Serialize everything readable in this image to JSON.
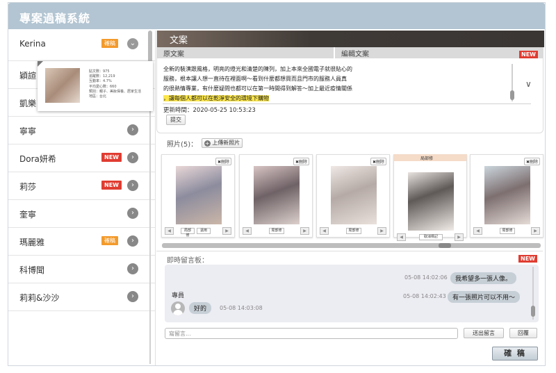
{
  "app": {
    "title": "專案過稿系統"
  },
  "sidebar": {
    "items": [
      {
        "name": "Kerina",
        "badge": "確稿",
        "badge_type": "orange",
        "expanded": true
      },
      {
        "name": "穎諠",
        "badge": "",
        "badge_type": ""
      },
      {
        "name": "凱樂",
        "badge": "",
        "badge_type": ""
      },
      {
        "name": "寧寧",
        "badge": "",
        "badge_type": ""
      },
      {
        "name": "Dora妍希",
        "badge": "NEW",
        "badge_type": "red"
      },
      {
        "name": "莉莎",
        "badge": "NEW",
        "badge_type": "red"
      },
      {
        "name": "奎寧",
        "badge": "",
        "badge_type": ""
      },
      {
        "name": "瑪麗雅",
        "badge": "確稿",
        "badge_type": "orange"
      },
      {
        "name": "科博聞",
        "badge": "",
        "badge_type": ""
      },
      {
        "name": "莉莉&沙沙",
        "badge": "",
        "badge_type": ""
      }
    ],
    "popup": {
      "stats": [
        "貼文數：975",
        "追蹤數：12,219",
        "互動率：4.7%",
        "平均愛心數：660",
        "類別：親子、美妝保養、居家生活",
        "地區：台北"
      ]
    }
  },
  "copy": {
    "header": "文案",
    "col_original": "原文案",
    "col_edit": "編輯文案",
    "new_label": "NEW",
    "lines": [
      "全新的裝潢跟風格，明亮的燈光和清楚的陳列，加上本來全國電子就很貼心的",
      "服務，根本讓人想一直待在裡面啊～看到什麼都想買而且門市的服務人員真",
      "的很熱情專業，有什麼疑問也都可以在第一時間得到解答～加上最近疫情關係"
    ],
    "highlight_line": "，讓每個人都可以在乾淨安全的環境下購物",
    "updated": "更新時間：2020-05-25 10:53:23",
    "submit_label": "提交"
  },
  "photos": {
    "label": "照片(5)：",
    "upload_label": "上傳新照片",
    "cards": [
      {
        "tag": "刪除",
        "tag_icon": "✖",
        "actions": [
          "局部修",
          "退用"
        ]
      },
      {
        "tag": "刪除",
        "tag_icon": "✖",
        "actions": [
          "局部修"
        ]
      },
      {
        "tag": "刪除",
        "tag_icon": "✖",
        "actions": [
          "局部修"
        ]
      },
      {
        "tag": "局部修",
        "tag_icon": "",
        "actions": [
          "取消標記"
        ],
        "selected": true
      },
      {
        "tag": "刪除",
        "tag_icon": "✖",
        "actions": [
          "局部修"
        ]
      }
    ]
  },
  "chat": {
    "label": "即時留言板：",
    "new_label": "NEW",
    "messages": [
      {
        "side": "right",
        "time": "05-08 14:02:06",
        "text": "我希望多一張人像。"
      },
      {
        "side": "right",
        "time": "05-08 14:02:43",
        "text": "有一張照片可以不用～"
      },
      {
        "side": "left",
        "sender": "專員",
        "time": "05-08 14:03:08",
        "text": "好的"
      }
    ],
    "input_placeholder": "寫留言...",
    "send_label": "送出留言",
    "reply_label": "回覆"
  },
  "confirm_label": "確 稿"
}
